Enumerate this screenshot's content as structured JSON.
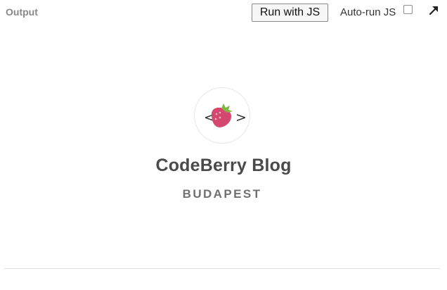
{
  "header": {
    "title": "Output",
    "run_button_label": "Run with JS",
    "autorun_label": "Auto-run JS",
    "autorun_checked": false,
    "expand_icon": "expand-arrow-icon"
  },
  "preview": {
    "logo": {
      "icon": "strawberry-code-icon",
      "left_bracket": "<",
      "right_bracket": ">",
      "colors": {
        "berry": "#d6476f",
        "leaf": "#7fb744",
        "ring": "#e6e6e6",
        "brackets": "#333333"
      }
    },
    "title": "CodeBerry Blog",
    "location": "BUDAPEST"
  }
}
